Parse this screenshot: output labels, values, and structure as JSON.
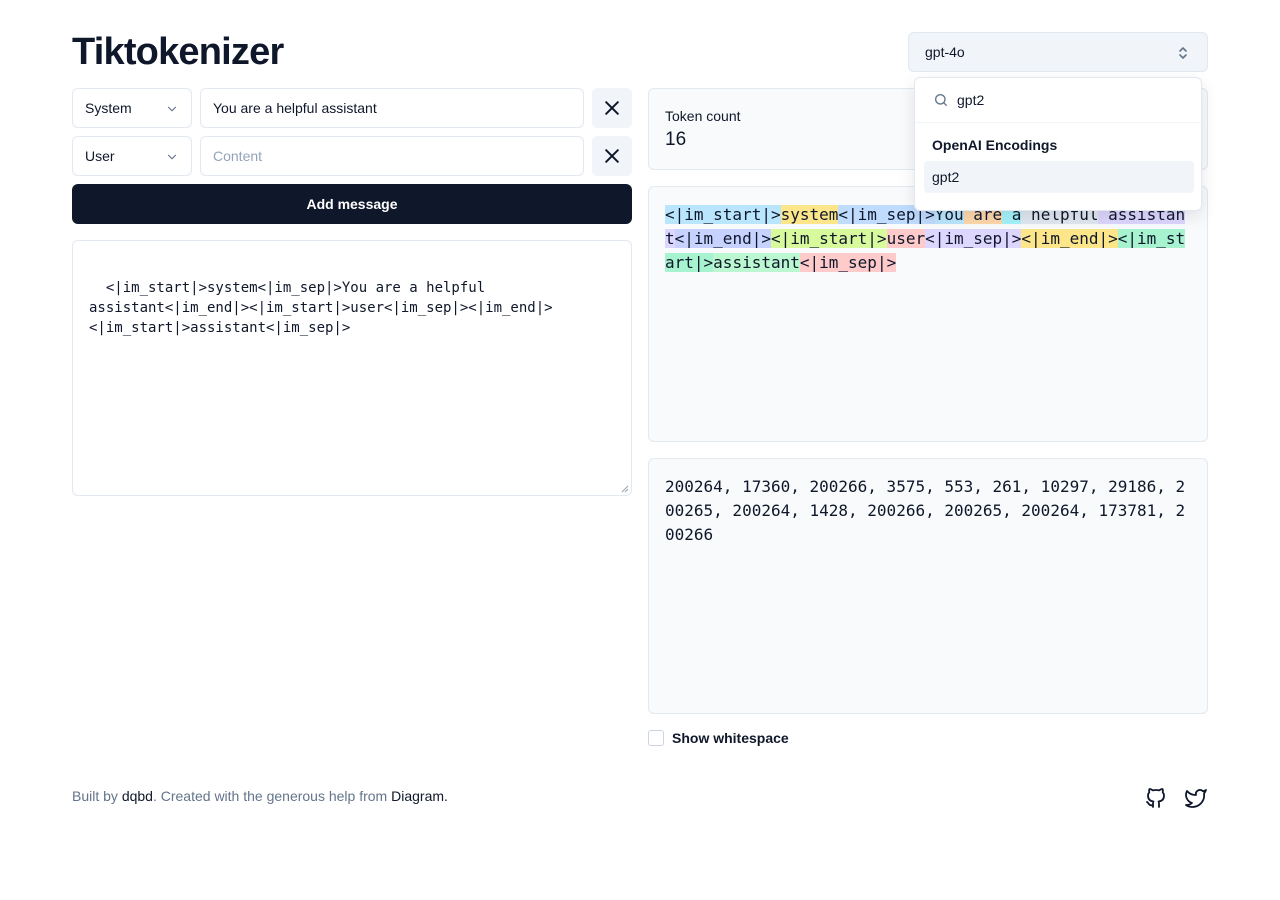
{
  "app": {
    "title": "Tiktokenizer"
  },
  "messages": [
    {
      "role": "System",
      "content": "You are a helpful assistant",
      "placeholder": "Content"
    },
    {
      "role": "User",
      "content": "",
      "placeholder": "Content"
    }
  ],
  "add_message_label": "Add message",
  "prompt_text": "<|im_start|>system<|im_sep|>You are a helpful\nassistant<|im_end|><|im_start|>user<|im_sep|><|im_end|>\n<|im_start|>assistant<|im_sep|>",
  "model_select": {
    "value": "gpt-4o"
  },
  "dropdown": {
    "search_value": "gpt2",
    "group_label": "OpenAI Encodings",
    "items": [
      "gpt2"
    ]
  },
  "token_count": {
    "label": "Token count",
    "value": "16"
  },
  "tokens": [
    {
      "text": "<|im_start|>",
      "color": "#bae6fd"
    },
    {
      "text": "system",
      "color": "#fde68a"
    },
    {
      "text": "<|im_sep|>",
      "color": "#bfdbfe"
    },
    {
      "text": "You",
      "color": "#bae6fd"
    },
    {
      "text": " are",
      "color": "#fed7aa"
    },
    {
      "text": " a",
      "color": "#a5f3fc"
    },
    {
      "text": " helpful",
      "color": "#e2e8f0"
    },
    {
      "text": " assistant",
      "color": "#ddd6fe"
    },
    {
      "text": "<|im_end|>",
      "color": "#c7d2fe"
    },
    {
      "text": "<|im_start|>",
      "color": "#d9f99d"
    },
    {
      "text": "user",
      "color": "#fecaca"
    },
    {
      "text": "<|im_sep|>",
      "color": "#ddd6fe"
    },
    {
      "text": "<|im_end|>",
      "color": "#fde68a"
    },
    {
      "text": "<|im_start|>",
      "color": "#a7f3d0"
    },
    {
      "text": "assistant",
      "color": "#bbf7d0"
    },
    {
      "text": "<|im_sep|>",
      "color": "#fecaca"
    }
  ],
  "token_ids_text": "200264, 17360, 200266, 3575, 553, 261, 10297, 29186, 200265, 200264, 1428, 200266, 200265, 200264, 173781, 200266",
  "show_whitespace": {
    "label": "Show whitespace",
    "checked": false
  },
  "footer": {
    "built_by": "Built by ",
    "author": "dqbd",
    "created_with": ". Created with the generous help from ",
    "helper": "Diagram",
    "end": "."
  },
  "icons": {
    "github": "github-icon",
    "twitter": "twitter-icon",
    "search": "search-icon",
    "close": "close-icon",
    "chevron": "chevron-down-icon",
    "updown": "chevron-up-down-icon"
  },
  "colors": {
    "primary": "#0f172a",
    "muted": "#64748b",
    "border": "#e2e8f0",
    "card_bg": "#f8fafc"
  }
}
